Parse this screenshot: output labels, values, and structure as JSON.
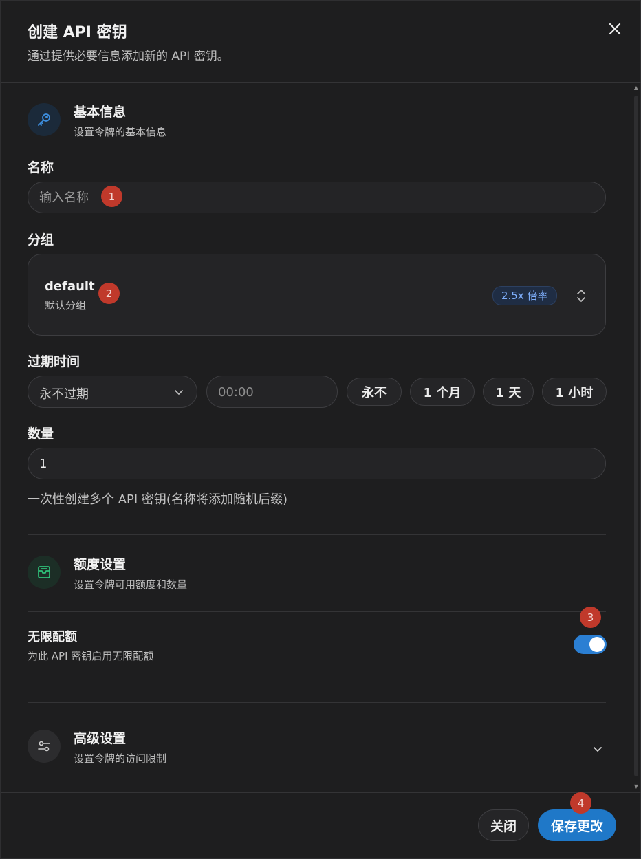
{
  "header": {
    "title": "创建 API 密钥",
    "subtitle": "通过提供必要信息添加新的 API 密钥。"
  },
  "basic_section": {
    "title": "基本信息",
    "subtitle": "设置令牌的基本信息",
    "icon": "key-icon"
  },
  "name_field": {
    "label": "名称",
    "placeholder": "输入名称",
    "value": ""
  },
  "group_field": {
    "label": "分组",
    "selected_name": "default",
    "selected_desc": "默认分组",
    "ratio_badge": "2.5x 倍率"
  },
  "expiry_field": {
    "label": "过期时间",
    "select_value": "永不过期",
    "time_value": "00:00",
    "quick_buttons": [
      "永不",
      "1 个月",
      "1 天",
      "1 小时"
    ]
  },
  "quantity_field": {
    "label": "数量",
    "value": "1",
    "help": "一次性创建多个 API 密钥(名称将添加随机后缀)"
  },
  "quota_section": {
    "title": "额度设置",
    "subtitle": "设置令牌可用额度和数量",
    "icon": "wallet-icon"
  },
  "unlimited_quota": {
    "title": "无限配额",
    "subtitle": "为此 API 密钥启用无限配额",
    "enabled": true
  },
  "advanced_section": {
    "title": "高级设置",
    "subtitle": "设置令牌的访问限制",
    "icon": "sliders-icon"
  },
  "footer": {
    "close_label": "关闭",
    "save_label": "保存更改"
  },
  "markers": [
    "1",
    "2",
    "3",
    "4"
  ],
  "colors": {
    "background": "#1e1e1f",
    "accent": "#1f78c8",
    "badge_text": "#7eaefb",
    "marker": "#c0392b",
    "key_icon": "#3d8fe0",
    "wallet_icon": "#2fc27a"
  }
}
